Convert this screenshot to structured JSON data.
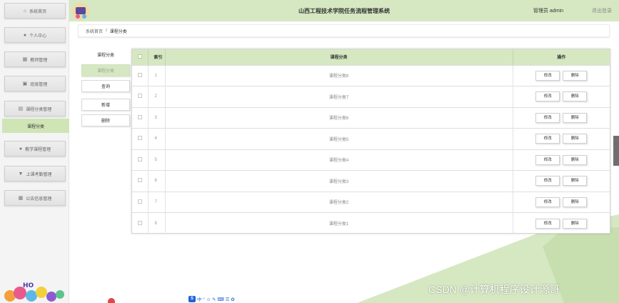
{
  "header": {
    "title": "山西工程技术学院任务流程管理系统",
    "user_label": "管理员 admin",
    "logout_label": "退出登录"
  },
  "sidebar": {
    "items": [
      {
        "label": "系统首页",
        "icon": "home-icon"
      },
      {
        "label": "个人中心",
        "icon": "user-icon"
      },
      {
        "label": "教师管理",
        "icon": "grid-icon"
      },
      {
        "label": "班级管理",
        "icon": "building-icon"
      },
      {
        "label": "课程分类管理",
        "icon": "doc-icon"
      },
      {
        "label": "教学课程管理",
        "icon": "user-icon"
      },
      {
        "label": "上课考勤管理",
        "icon": "bookmark-icon"
      },
      {
        "label": "公告信息管理",
        "icon": "grid-icon"
      }
    ],
    "active_sub": "课程分类"
  },
  "breadcrumb": {
    "home": "系统首页",
    "separator": "/",
    "current": "课程分类"
  },
  "submenu": {
    "title": "课程分类",
    "items": [
      "课程分类",
      "查询",
      "新增",
      "删除"
    ]
  },
  "table": {
    "columns": [
      "索引",
      "课程分类",
      "操作"
    ],
    "rows": [
      {
        "index": "1",
        "name": "课程分类8"
      },
      {
        "index": "2",
        "name": "课程分类7"
      },
      {
        "index": "3",
        "name": "课程分类6"
      },
      {
        "index": "4",
        "name": "课程分类5"
      },
      {
        "index": "5",
        "name": "课程分类4"
      },
      {
        "index": "6",
        "name": "课程分类3"
      },
      {
        "index": "7",
        "name": "课程分类2"
      },
      {
        "index": "8",
        "name": "课程分类1"
      }
    ],
    "edit_label": "修改",
    "delete_label": "删除"
  },
  "watermark": "CSDN @计算机程序设计源哥",
  "ime": {
    "badge": "S",
    "glyphs": "中 ° ☺ ✎ ⌨ ☰ ✿"
  },
  "colors": {
    "accent": "#d6e8c2",
    "active": "#cfe5b6",
    "scrollbar": "#6f6f6f"
  }
}
